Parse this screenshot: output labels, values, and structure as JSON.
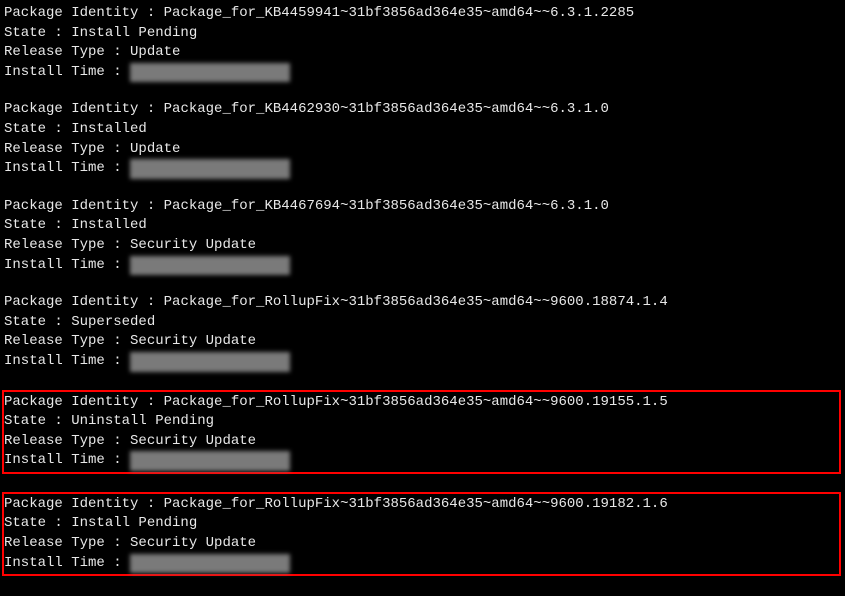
{
  "labels": {
    "package_identity": "Package Identity : ",
    "state": "State : ",
    "release_type": "Release Type : ",
    "install_time": "Install Time : "
  },
  "packages": [
    {
      "identity": "Package_for_KB4459941~31bf3856ad364e35~amd64~~6.3.1.2285",
      "state": "Install Pending",
      "release_type": "Update",
      "install_time_redacted": "XX/XX/XXXX / XX: XX",
      "highlighted": false
    },
    {
      "identity": "Package_for_KB4462930~31bf3856ad364e35~amd64~~6.3.1.0",
      "state": "Installed",
      "release_type": "Update",
      "install_time_redacted": "XX/XX/XXXX / XX: XX",
      "highlighted": false
    },
    {
      "identity": "Package_for_KB4467694~31bf3856ad364e35~amd64~~6.3.1.0",
      "state": "Installed",
      "release_type": "Security Update",
      "install_time_redacted": "XX/XX/XXXX / XX: XX",
      "highlighted": false
    },
    {
      "identity": "Package_for_RollupFix~31bf3856ad364e35~amd64~~9600.18874.1.4",
      "state": "Superseded",
      "release_type": "Security Update",
      "install_time_redacted": "XX/XX/XXXX / XX: XX",
      "highlighted": false
    },
    {
      "identity": "Package_for_RollupFix~31bf3856ad364e35~amd64~~9600.19155.1.5",
      "state": "Uninstall Pending",
      "release_type": "Security Update",
      "install_time_redacted": "XX/XX/XXXX / XX: XX",
      "highlighted": true
    },
    {
      "identity": "Package_for_RollupFix~31bf3856ad364e35~amd64~~9600.19182.1.6",
      "state": "Install Pending",
      "release_type": "Security Update",
      "install_time_redacted": "XX/XX/XXXX / XX: XX",
      "highlighted": true
    }
  ]
}
